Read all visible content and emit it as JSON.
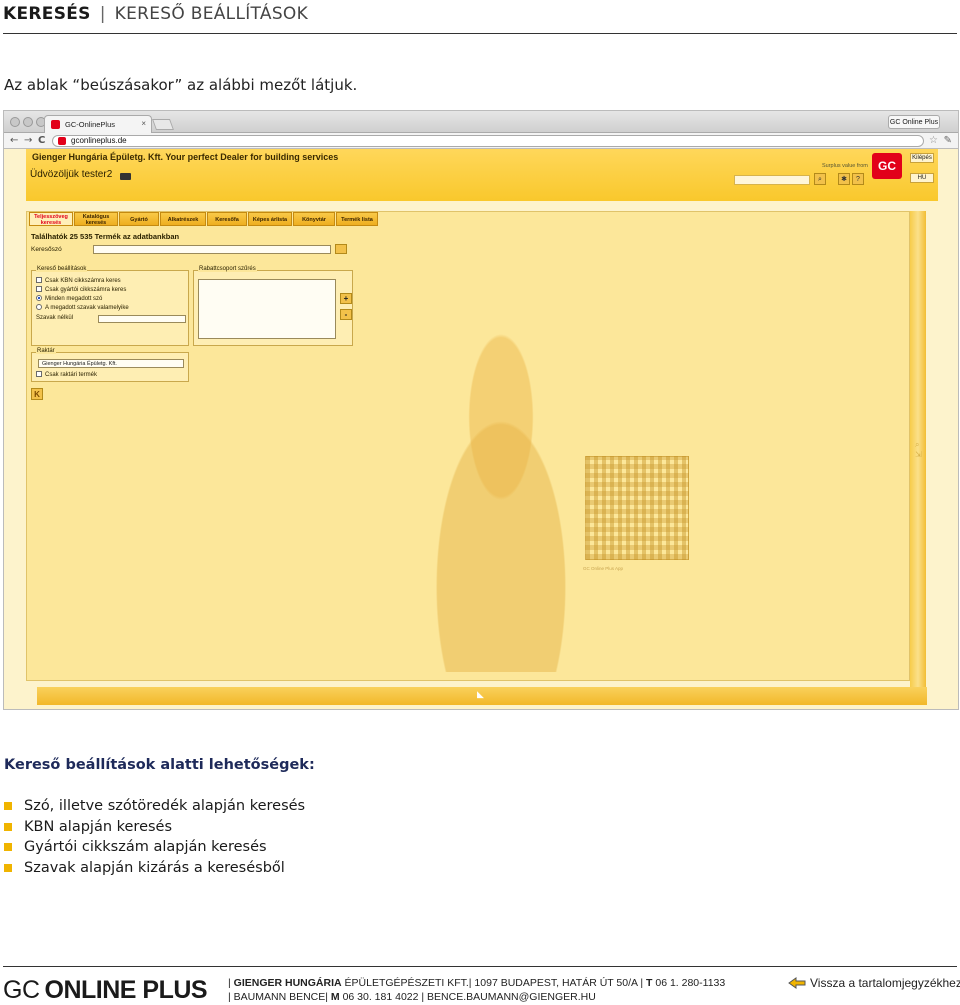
{
  "header": {
    "title_strong": "KERESÉS",
    "separator": "|",
    "title_light": "KERESŐ BEÁLLÍTÁSOK"
  },
  "intro_text": "Az ablak “beúszásakor” az alábbi mezőt látjuk.",
  "browser": {
    "tab_title": "GC-OnlinePlus",
    "tab_close": "×",
    "url": "gconlineplus.de",
    "app_badge": "GC Online Plus",
    "back_glyph": "←",
    "forward_glyph": "→",
    "reload_glyph": "C"
  },
  "site": {
    "brand_line": "Gienger Hungária Épületg. Kft. Your perfect Dealer for building services",
    "welcome": "Üdvözöljük tester2",
    "surplus_label": "Surplus value from",
    "logo_text": "GC",
    "logout_label": "Kilépés",
    "language": "HU",
    "icon_help": "?",
    "tabs": [
      {
        "label": "Teljesszöveg keresés",
        "active": true
      },
      {
        "label": "Katalógus keresés",
        "active": false
      },
      {
        "label": "Gyártó",
        "active": false
      },
      {
        "label": "Alkatrészek",
        "active": false
      },
      {
        "label": "Keresőfa",
        "active": false
      },
      {
        "label": "Képes árlista",
        "active": false
      },
      {
        "label": "Könyvtár",
        "active": false
      },
      {
        "label": "Termék lista",
        "active": false
      }
    ],
    "found_text": "Találhatók 25 535 Termék az adatbankban",
    "keyword_label": "Keresőszó",
    "search_settings": {
      "legend": "Kereső beállítások",
      "options": [
        {
          "label": "Csak KBN cikkszámra keres",
          "type": "checkbox",
          "checked": false
        },
        {
          "label": "Csak gyártói cikkszámra keres",
          "type": "checkbox",
          "checked": false
        },
        {
          "label": "Minden megadott szó",
          "type": "radio",
          "checked": true
        },
        {
          "label": "A megadott szavak valamelyike",
          "type": "radio",
          "checked": false
        }
      ],
      "exclude_label": "Szavak nélkül"
    },
    "discount": {
      "legend": "Rabattcsoport szűrés",
      "plus": "+",
      "minus": "-"
    },
    "warehouse": {
      "legend": "Raktár",
      "selected": "Gienger Hungária Épületg. Kft.",
      "stock_only": "Csak raktári termék"
    },
    "back_button": "K",
    "qr_caption": "GC Online Plus App"
  },
  "section_heading": "Kereső beállítások alatti lehetőségek:",
  "bullets": [
    "Szó, illetve szótöredék alapján keresés",
    "KBN alapján keresés",
    "Gyártói cikkszám alapján keresés",
    "Szavak alapján kizárás a keresésből"
  ],
  "footer": {
    "logo_gc": "GC",
    "logo_rest": "ONLINE PLUS",
    "company_bold": "GIENGER HUNGÁRIA",
    "company_rest": " ÉPÜLETGÉPÉSZETI KFT.| 1097 BUDAPEST, HATÁR ÚT 50/A |",
    "t_label": " T",
    "phone": " 06 1. 280-1133",
    "contact_name": "BAUMANN BENCE|",
    "m_label": " M",
    "mobile": " 06 30. 181 4022 | BENCE.BAUMANN@GIENGER.HU",
    "back_link": "Vissza a tartalomjegyzékhez"
  },
  "colors": {
    "accent_yellow": "#f0b400",
    "site_yellow": "#fce79a",
    "brand_red": "#e2001a",
    "heading_blue": "#1e2a5a"
  }
}
